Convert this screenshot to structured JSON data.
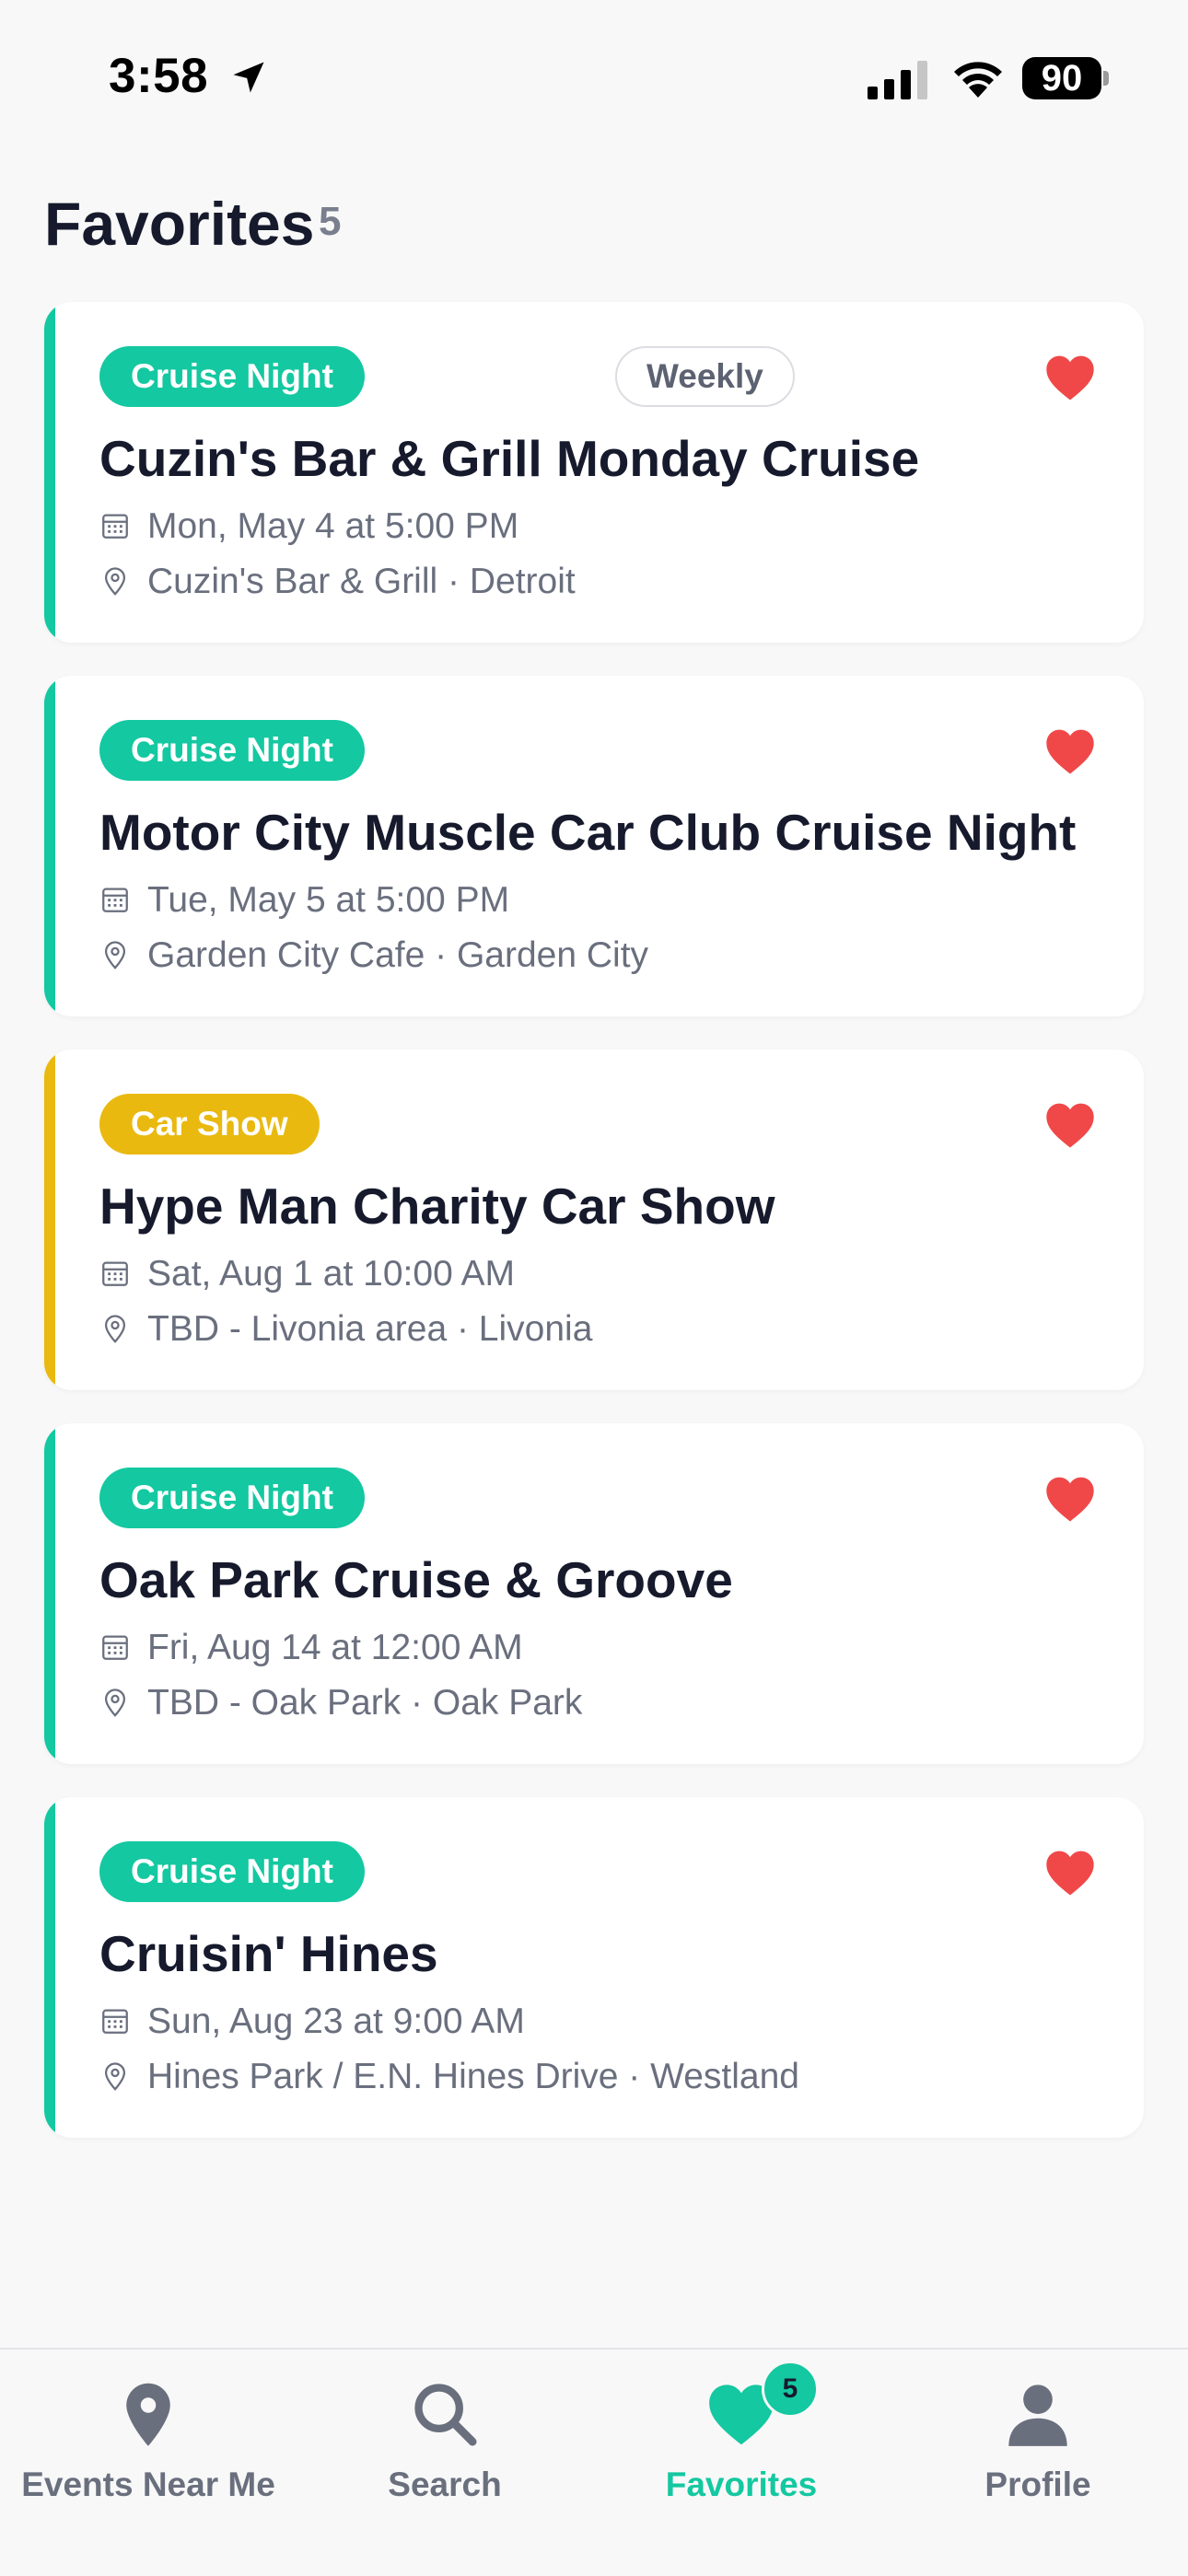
{
  "status_bar": {
    "time": "3:58",
    "battery": "90"
  },
  "header": {
    "title": "Favorites",
    "count": "5"
  },
  "colors": {
    "cruise_night": "#14c8a1",
    "car_show": "#e9b90f",
    "heart": "#f04848",
    "active_tab": "#14c8a1"
  },
  "events": [
    {
      "tag": "Cruise Night",
      "tag_type": "cruise_night",
      "recurrence": "Weekly",
      "title": "Cuzin's Bar & Grill Monday Cruise",
      "date": "Mon, May 4 at 5:00 PM",
      "location": "Cuzin's Bar & Grill · Detroit",
      "favorited": true
    },
    {
      "tag": "Cruise Night",
      "tag_type": "cruise_night",
      "title": "Motor City Muscle Car Club Cruise Night",
      "date": "Tue, May 5 at 5:00 PM",
      "location": "Garden City Cafe · Garden City",
      "favorited": true
    },
    {
      "tag": "Car Show",
      "tag_type": "car_show",
      "title": "Hype Man Charity Car Show",
      "date": "Sat, Aug 1 at 10:00 AM",
      "location": "TBD - Livonia area · Livonia",
      "favorited": true
    },
    {
      "tag": "Cruise Night",
      "tag_type": "cruise_night",
      "title": "Oak Park Cruise & Groove",
      "date": "Fri, Aug 14 at 12:00 AM",
      "location": "TBD - Oak Park · Oak Park",
      "favorited": true
    },
    {
      "tag": "Cruise Night",
      "tag_type": "cruise_night",
      "title": "Cruisin' Hines",
      "date": "Sun, Aug 23 at 9:00 AM",
      "location": "Hines Park / E.N. Hines Drive · Westland",
      "favorited": true
    }
  ],
  "tab_bar": {
    "tabs": [
      {
        "label": "Events Near Me",
        "icon": "map-pin-icon"
      },
      {
        "label": "Search",
        "icon": "search-icon"
      },
      {
        "label": "Favorites",
        "icon": "heart-icon",
        "badge": "5",
        "active": true
      },
      {
        "label": "Profile",
        "icon": "person-icon"
      }
    ]
  }
}
